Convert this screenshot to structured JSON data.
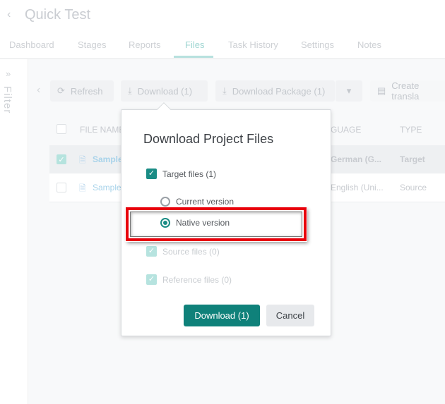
{
  "header": {
    "back_icon": "chevron-left-icon",
    "title": "Quick Test"
  },
  "tabs": [
    {
      "label": "Dashboard"
    },
    {
      "label": "Stages"
    },
    {
      "label": "Reports"
    },
    {
      "label": "Files",
      "active": true
    },
    {
      "label": "Task History"
    },
    {
      "label": "Settings"
    },
    {
      "label": "Notes"
    }
  ],
  "sidebar": {
    "label": "Filter",
    "icon": "double-chevron-right-icon"
  },
  "toolbar": {
    "refresh": "Refresh",
    "download": "Download (1)",
    "download_package": "Download Package (1)",
    "create": "Create transla"
  },
  "table": {
    "headers": [
      "FILE NAME",
      "GUAGE",
      "TYPE"
    ],
    "rows": [
      {
        "name": "Sample",
        "language": "German (G...",
        "type": "Target",
        "checked": true
      },
      {
        "name": "Sample",
        "language": "English (Uni...",
        "type": "Source",
        "checked": false
      }
    ]
  },
  "dialog": {
    "title": "Download Project Files",
    "target": "Target files (1)",
    "current": "Current version",
    "native": "Native version",
    "source": "Source files (0)",
    "reference": "Reference files (0)",
    "download": "Download (1)",
    "cancel": "Cancel"
  },
  "colors": {
    "accent": "#0f817a",
    "highlight": "#e8000b"
  }
}
